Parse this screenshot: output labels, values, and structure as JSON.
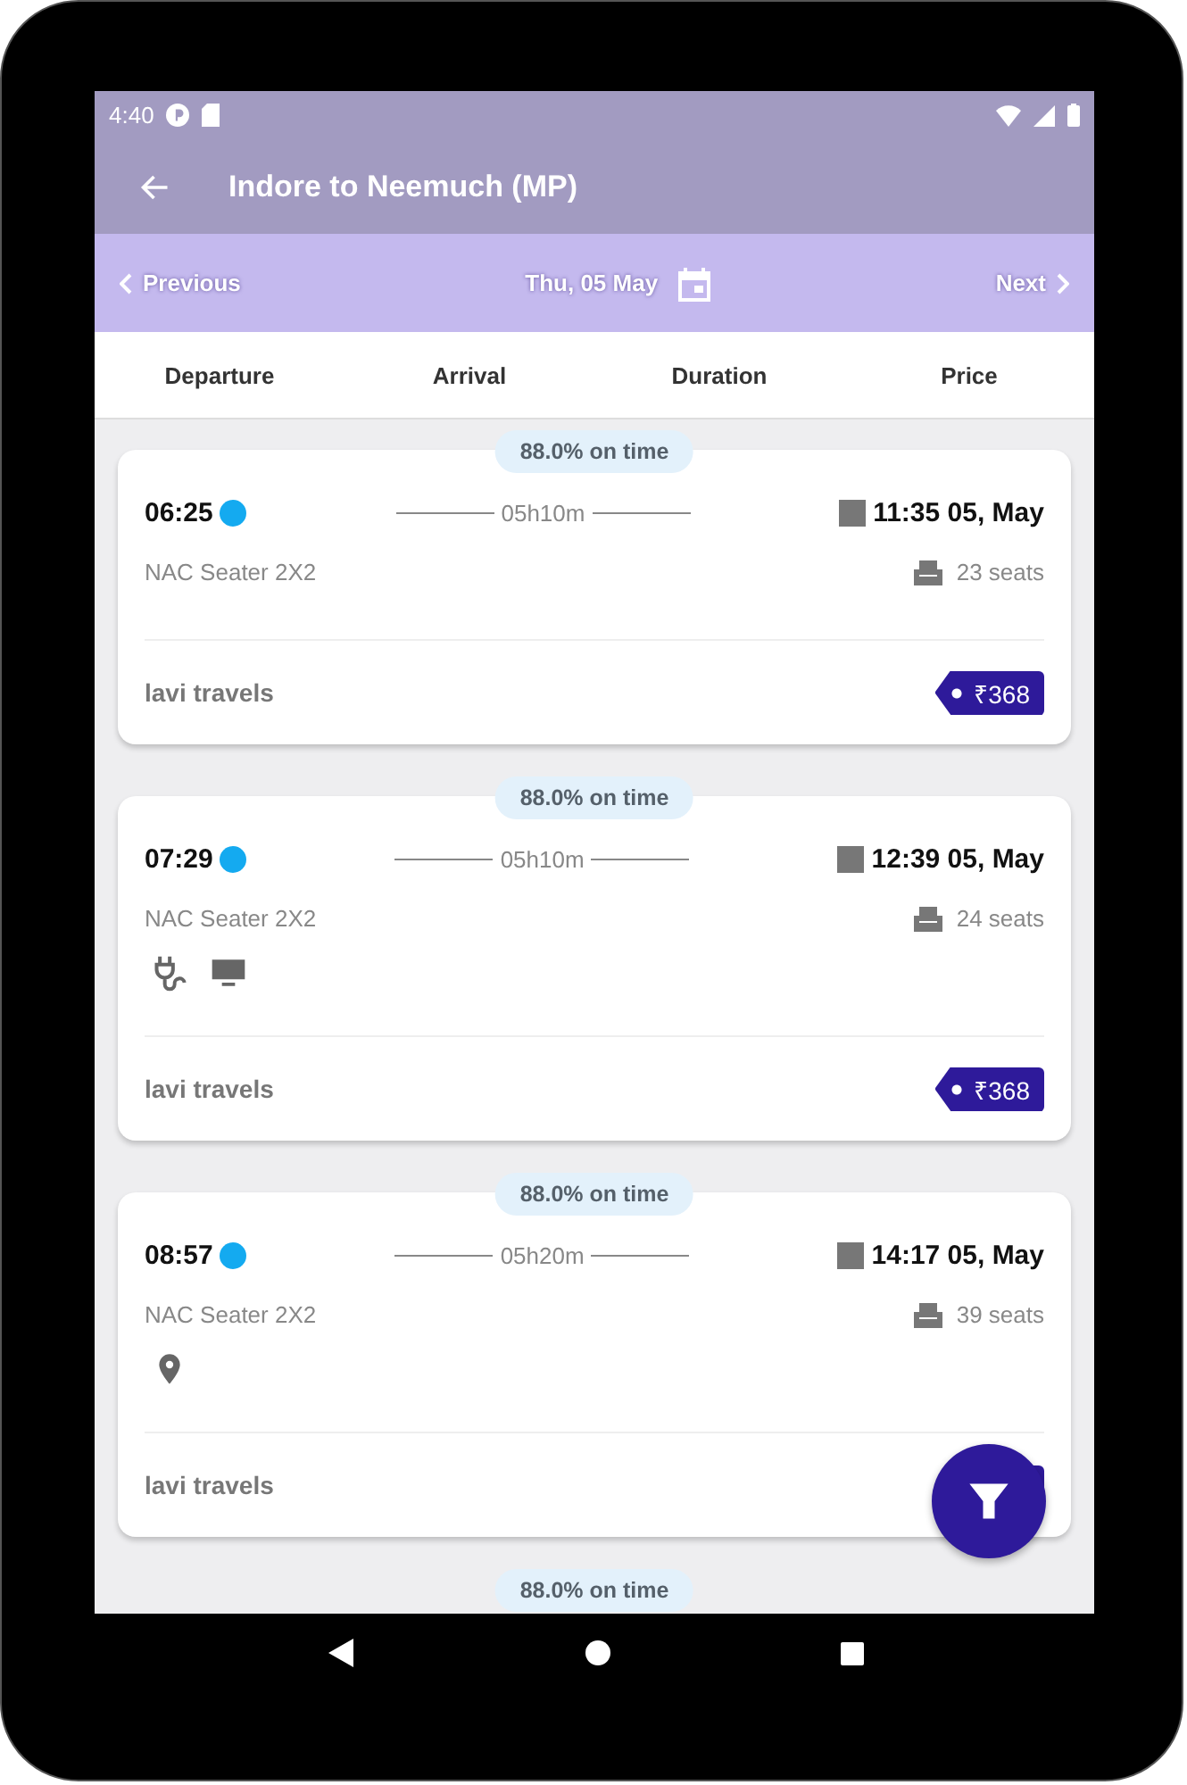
{
  "status_bar": {
    "time": "4:40"
  },
  "app_bar": {
    "title": "Indore to Neemuch (MP)"
  },
  "date_bar": {
    "previous": "Previous",
    "date": "Thu, 05 May",
    "next": "Next"
  },
  "sort_tabs": [
    "Departure",
    "Arrival",
    "Duration",
    "Price"
  ],
  "trips": [
    {
      "on_time": "88.0% on time",
      "departure": "06:25",
      "duration": "05h10m",
      "arrival": "11:35 05, May",
      "bus_type": "NAC Seater 2X2",
      "seats": "23 seats",
      "operator": "lavi travels",
      "price": "₹368"
    },
    {
      "on_time": "88.0% on time",
      "departure": "07:29",
      "duration": "05h10m",
      "arrival": "12:39 05, May",
      "bus_type": "NAC Seater 2X2",
      "seats": "24 seats",
      "amenities": [
        {
          "kind": "charging"
        },
        {
          "kind": "tv"
        }
      ],
      "operator": "lavi travels",
      "price": "₹368"
    },
    {
      "on_time": "88.0% on time",
      "departure": "08:57",
      "duration": "05h20m",
      "arrival": "14:17 05, May",
      "bus_type": "NAC Seater 2X2",
      "seats": "39 seats",
      "amenities": [
        {
          "kind": "location"
        }
      ],
      "operator": "lavi travels"
    },
    {
      "on_time": "88.0% on time"
    }
  ]
}
